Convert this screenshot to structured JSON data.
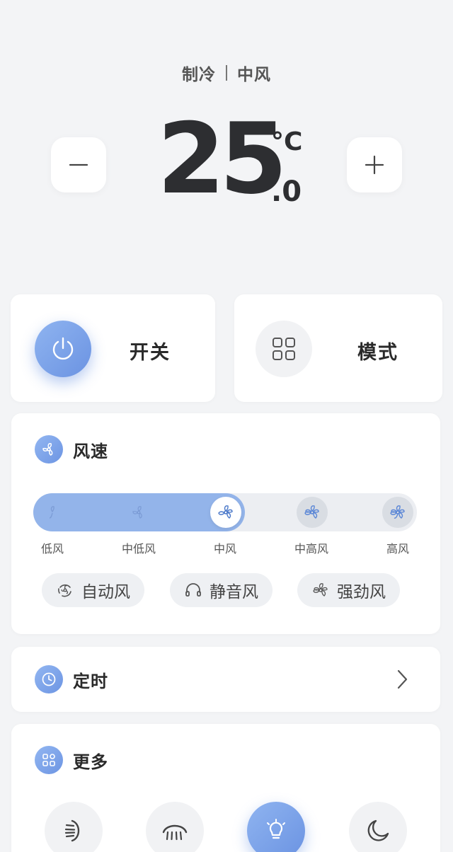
{
  "status": {
    "mode": "制冷",
    "fan": "中风"
  },
  "temperature": {
    "value": "25",
    "unit": "°C",
    "decimal": ".0",
    "minus_label": "−",
    "plus_label": "+"
  },
  "controls": {
    "power_label": "开关",
    "mode_label": "模式"
  },
  "fan_speed": {
    "title": "风速",
    "levels": [
      "低风",
      "中低风",
      "中风",
      "中高风",
      "高风"
    ],
    "selected_index": 2,
    "presets": [
      "自动风",
      "静音风",
      "强劲风"
    ]
  },
  "timer": {
    "title": "定时"
  },
  "more": {
    "title": "更多",
    "items": [
      "swing-vertical-icon",
      "swing-horizontal-icon",
      "light-icon",
      "sleep-icon"
    ],
    "active_index": 2
  },
  "colors": {
    "accent": "#7ea3e8",
    "background": "#f3f4f6"
  }
}
